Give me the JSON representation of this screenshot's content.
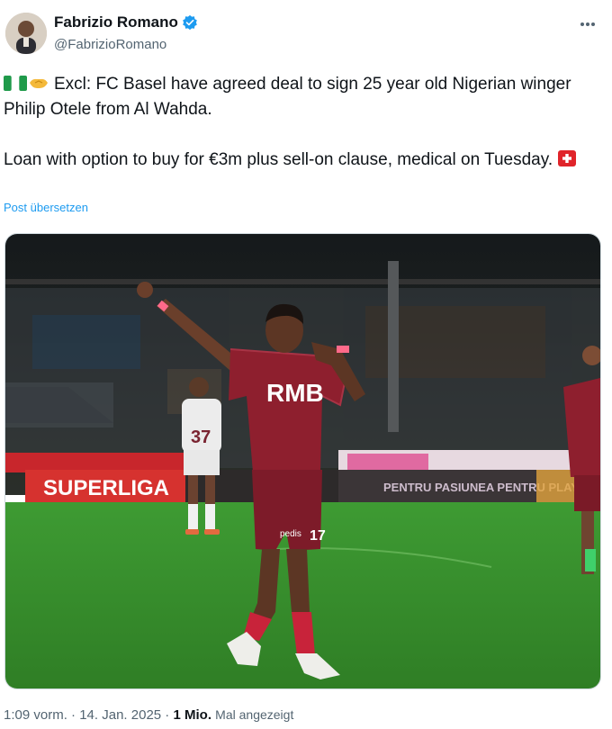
{
  "author": {
    "display_name": "Fabrizio Romano",
    "handle": "@FabrizioRomano"
  },
  "tweet": {
    "line1": "Excl: FC Basel have agreed deal to sign 25 year old Nigerian winger Philip Otele from Al Wahda.",
    "line2": "Loan with option to buy for €3m plus sell-on clause, medical on Tuesday.",
    "translate_label": "Post übersetzen",
    "emojis": [
      "nigeria-flag",
      "handshake",
      "switzerland-flag"
    ]
  },
  "media": {
    "shirt_sponsor": "RMB",
    "shorts_number": "17",
    "board_left": "SUPERLIGA",
    "board_right": "PENTRU PASIUNEA PENTRU PLAY",
    "opponent_number": "37",
    "colors": {
      "kit": "#8e1f2e",
      "pitch": "#3f9a31",
      "sky": "#1d2326"
    }
  },
  "meta": {
    "time": "1:09 vorm.",
    "sep1": " · ",
    "date": "14. Jan. 2025",
    "sep2": " · ",
    "views_count": "1 Mio.",
    "views_label": "Mal angezeigt"
  },
  "colors": {
    "accent": "#1d9bf0",
    "muted": "#536471",
    "text": "#0f1419"
  }
}
